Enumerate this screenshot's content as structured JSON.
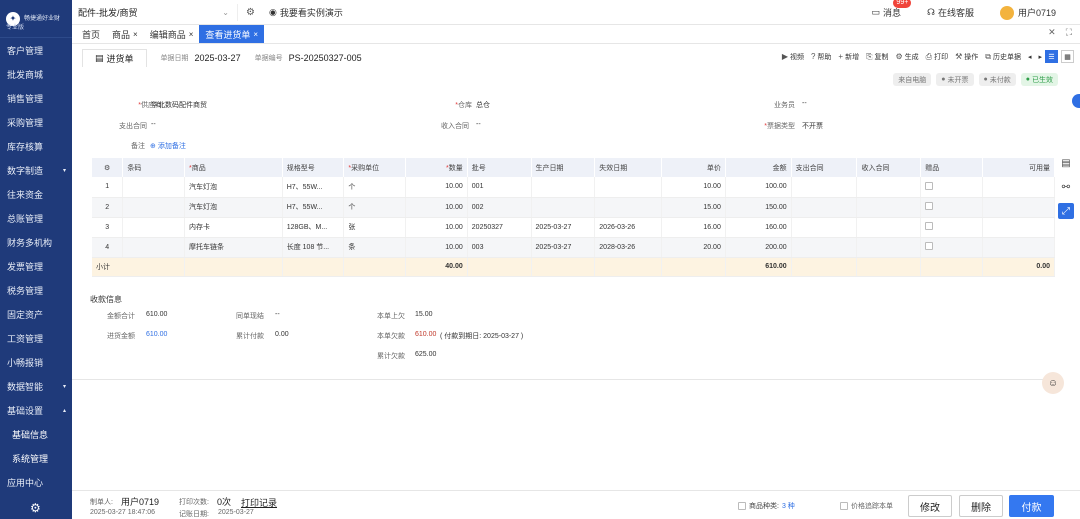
{
  "sidebar": {
    "logo_name": "畅捷通好业财",
    "edition": "专业版",
    "items": [
      {
        "label": "客户管理"
      },
      {
        "label": "批发商城"
      },
      {
        "label": "销售管理"
      },
      {
        "label": "采购管理"
      },
      {
        "label": "库存核算"
      },
      {
        "label": "数字制造",
        "arrow": "▾"
      },
      {
        "label": "往来资金"
      },
      {
        "label": "总账管理"
      },
      {
        "label": "财务多机构"
      },
      {
        "label": "发票管理"
      },
      {
        "label": "税务管理"
      },
      {
        "label": "固定资产"
      },
      {
        "label": "工资管理"
      },
      {
        "label": "小畅报销"
      },
      {
        "label": "数据智能",
        "arrow": "▾"
      },
      {
        "label": "基础设置",
        "arrow": "▴"
      },
      {
        "label": "基础信息"
      },
      {
        "label": "系统管理"
      },
      {
        "label": "应用中心"
      }
    ]
  },
  "topbar": {
    "scene": "配件-批发/商贸",
    "demo": "我要看实例演示",
    "messages": "消息",
    "msg_count": "99+",
    "service": "在线客服",
    "user": "用户0719"
  },
  "tabs": [
    {
      "label": "首页",
      "closable": ""
    },
    {
      "label": "商品",
      "closable": "×"
    },
    {
      "label": "编辑商品",
      "closable": "×"
    },
    {
      "label": "查看进货单",
      "closable": "×"
    }
  ],
  "doc": {
    "title": "进货单",
    "date_label": "单据日期",
    "date": "2025-03-27",
    "no_label": "单据编号",
    "no": "PS-20250327-005"
  },
  "actions": [
    "视频",
    "帮助",
    "新增",
    "复制",
    "生成",
    "打印",
    "操作",
    "历史单据"
  ],
  "statuses": [
    {
      "label": "来自电脑",
      "color": "gray"
    },
    {
      "label": "未开票",
      "color": "gray"
    },
    {
      "label": "未付款",
      "color": "gray"
    },
    {
      "label": "已生效",
      "color": "green"
    }
  ],
  "form": {
    "supplier_label": "供应商",
    "supplier": "华北数码配件商贸",
    "warehouse_label": "仓库",
    "warehouse": "总仓",
    "salesman_label": "业务员",
    "salesman": "--",
    "expense_contract_label": "支出合同",
    "expense_contract": "--",
    "income_contract_label": "收入合同",
    "income_contract": "--",
    "invoice_type_label": "票据类型",
    "invoice_type": "不开票",
    "remark_label": "备注",
    "add_remark": "添加备注"
  },
  "grid": {
    "columns": [
      "条码",
      "商品",
      "规格型号",
      "采购单位",
      "数量",
      "批号",
      "生产日期",
      "失效日期",
      "单价",
      "金额",
      "支出合同",
      "收入合同",
      "赠品",
      "可用量"
    ],
    "rows": [
      {
        "no": "1",
        "barcode": "",
        "product": "汽车灯泡",
        "spec": "H7、55W...",
        "unit": "个",
        "qty": "10.00",
        "batch": "001",
        "mfg": "",
        "exp": "",
        "price": "10.00",
        "amount": "100.00"
      },
      {
        "no": "2",
        "barcode": "",
        "product": "汽车灯泡",
        "spec": "H7、55W...",
        "unit": "个",
        "qty": "10.00",
        "batch": "002",
        "mfg": "",
        "exp": "",
        "price": "15.00",
        "amount": "150.00"
      },
      {
        "no": "3",
        "barcode": "",
        "product": "内存卡",
        "spec": "128GB、M...",
        "unit": "张",
        "qty": "10.00",
        "batch": "20250327",
        "mfg": "2025-03-27",
        "exp": "2026-03-26",
        "price": "16.00",
        "amount": "160.00"
      },
      {
        "no": "4",
        "barcode": "",
        "product": "摩托车链条",
        "spec": "长度 108 节...",
        "unit": "条",
        "qty": "10.00",
        "batch": "003",
        "mfg": "2025-03-27",
        "exp": "2028-03-26",
        "price": "20.00",
        "amount": "200.00"
      }
    ],
    "subtotal_label": "小计",
    "subtotal_qty": "40.00",
    "subtotal_amount": "610.00",
    "subtotal_available": "0.00"
  },
  "payment": {
    "title": "收款信息",
    "total_label": "金额合计",
    "total": "610.00",
    "purchase_label": "进货金额",
    "purchase": "610.00",
    "same_label": "同单现结",
    "same": "--",
    "cum_paid_label": "累计付款",
    "cum_paid": "0.00",
    "prev_label": "本单上欠",
    "prev": "15.00",
    "owed_label": "本单欠款",
    "owed": "610.00",
    "owed_note": "( 付款到期日: 2025-03-27 )",
    "cum_owed_label": "累计欠款",
    "cum_owed": "625.00"
  },
  "footer": {
    "maker_label": "制单人:",
    "maker": "用户0719",
    "made_time": "2025-03-27 18:47:06",
    "print_label": "打印次数:",
    "print_count": "0次",
    "print_log": "打印记录",
    "post_label": "记账日期:",
    "post_date": "2025-03-27",
    "kinds_label": "商品种类:",
    "kinds": "3 种",
    "price_track": "价格追踪本单",
    "btn_edit": "修改",
    "btn_delete": "删除",
    "btn_pay": "付款"
  },
  "colors": {
    "primary": "#2f6fe3",
    "sidebar": "#1f3a7a",
    "subtotal": "#fdf3e1"
  }
}
